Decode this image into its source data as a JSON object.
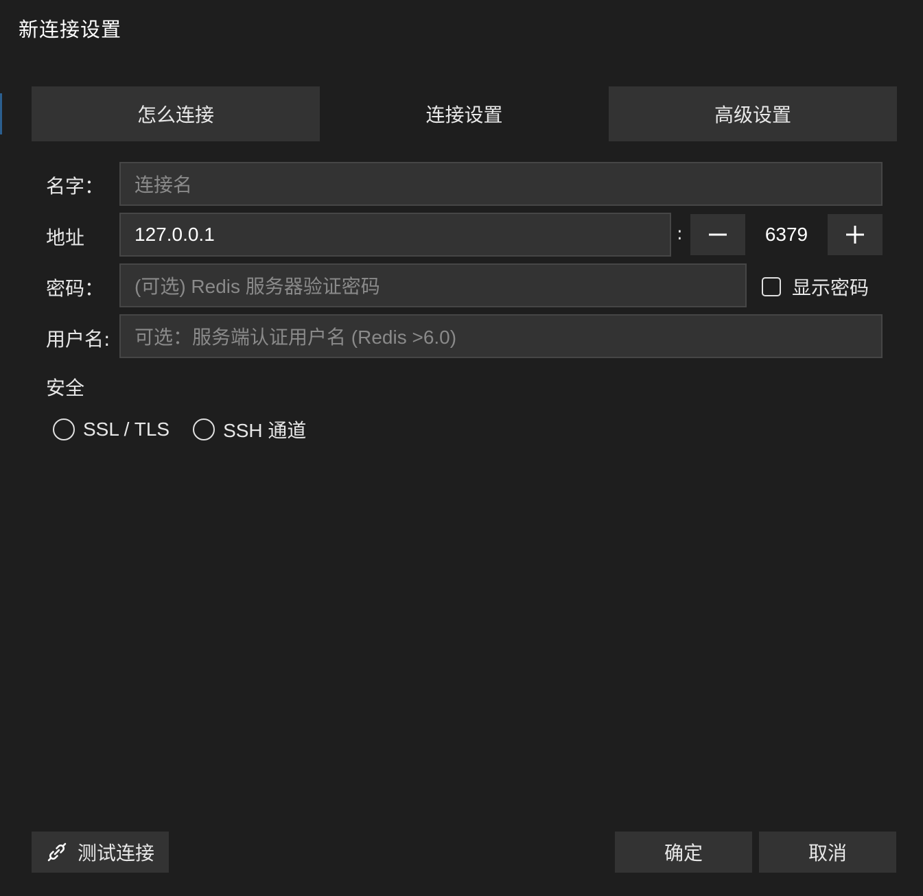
{
  "dialog": {
    "title": "新连接设置"
  },
  "tabs": [
    {
      "label": "怎么连接"
    },
    {
      "label": "连接设置",
      "active": true
    },
    {
      "label": "高级设置"
    }
  ],
  "form": {
    "name": {
      "label": "名字：",
      "value": "",
      "placeholder": "连接名"
    },
    "address": {
      "label": "地址",
      "value": "127.0.0.1",
      "separator": ":",
      "port": "6379",
      "decrement_icon": "minus-icon",
      "increment_icon": "plus-icon"
    },
    "password": {
      "label": "密码：",
      "value": "",
      "placeholder": "(可选) Redis 服务器验证密码",
      "show_password_label": "显示密码",
      "show_password_checked": false
    },
    "username": {
      "label": "用户名:",
      "value": "",
      "placeholder": "可选：服务端认证用户名 (Redis >6.0)"
    }
  },
  "security": {
    "title": "安全",
    "options": [
      {
        "label": "SSL / TLS",
        "selected": false
      },
      {
        "label": "SSH 通道",
        "selected": false
      }
    ]
  },
  "footer": {
    "test_label": "测试连接",
    "test_icon": "link-icon",
    "ok_label": "确定",
    "cancel_label": "取消"
  },
  "colors": {
    "background": "#1e1e1e",
    "surface": "#333333",
    "border": "#464646",
    "text": "#e8e8e8",
    "placeholder": "#8a8a8a",
    "accent": "#2b5f8f"
  }
}
